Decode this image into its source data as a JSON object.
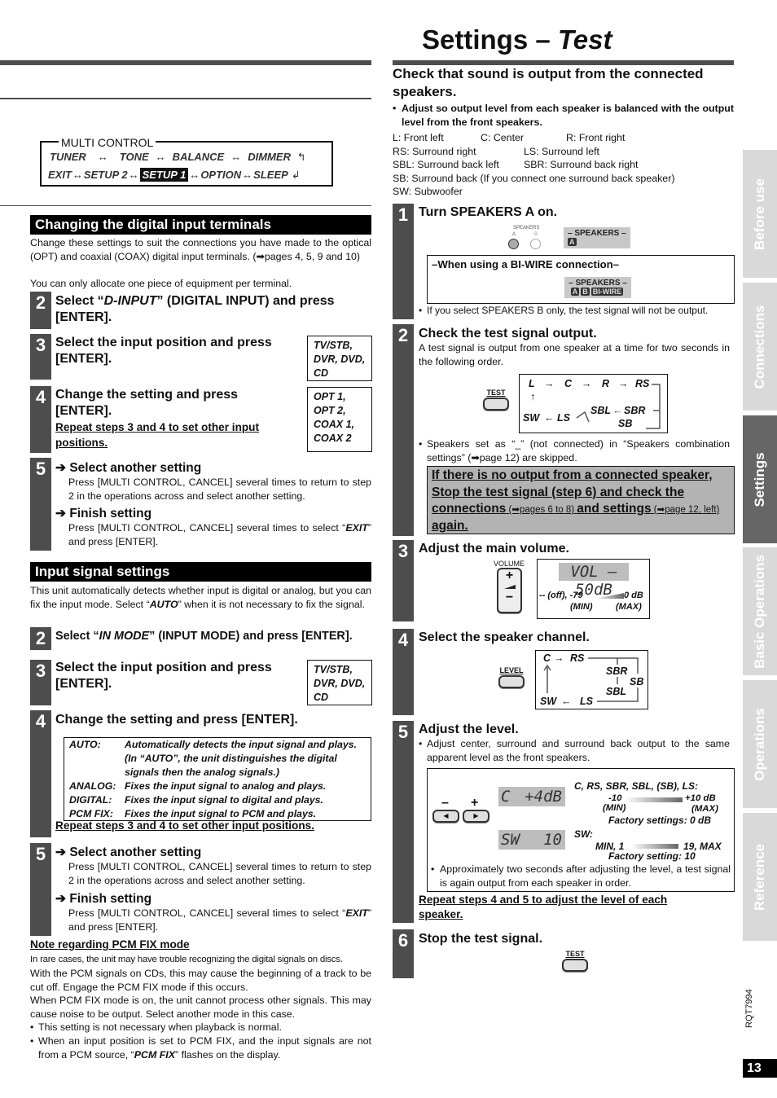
{
  "page": {
    "title_main": "Settings – ",
    "title_italic": "Test",
    "doc_code": "RQT7994",
    "page_number": "13"
  },
  "multi_control": {
    "legend": "MULTI CONTROL",
    "row1": [
      "TUNER",
      "TONE",
      "BALANCE",
      "DIMMER"
    ],
    "row2": [
      "EXIT",
      "SETUP 2",
      "SETUP 1",
      "OPTION",
      "SLEEP"
    ],
    "highlighted": "SETUP 1",
    "sep": "↔"
  },
  "digital_input": {
    "header": "Changing the digital input terminals",
    "intro1": "Change these settings to suit the connections you have made to the optical (OPT) and coaxial (COAX) digital input terminals. (➡pages 4, 5, 9 and 10)",
    "intro2": "You can only allocate one piece of equipment per terminal.",
    "step2": {
      "num": "2",
      "pre": "Select “",
      "ital": "D-INPUT",
      "post": "” (DIGITAL INPUT) and press [ENTER]."
    },
    "step3": {
      "num": "3",
      "title": "Select the input position and press [ENTER].",
      "options": [
        "TV/STB,",
        "DVR, DVD,",
        "CD"
      ]
    },
    "step4": {
      "num": "4",
      "title": "Change the setting and press [ENTER].",
      "repeat": "Repeat steps 3 and 4 to set other input positions.",
      "options": [
        "OPT 1,",
        "OPT 2,",
        "COAX 1,",
        "COAX 2"
      ]
    },
    "step5": {
      "num": "5",
      "another_head": "Select another setting",
      "another_text": "Press [MULTI CONTROL, CANCEL] several times to return to step 2 in the operations across and select another setting.",
      "finish_head": "Finish setting",
      "finish_text_pre": "Press [MULTI CONTROL, CANCEL] several times to select “",
      "finish_text_ital": "EXIT",
      "finish_text_post": "” and press [ENTER]."
    }
  },
  "input_signal": {
    "header": "Input signal settings",
    "intro_pre": "This unit automatically detects whether input is digital or analog, but you can fix the input mode. Select “",
    "intro_ital": "AUTO",
    "intro_post": "” when it is not necessary to fix the signal.",
    "step2": {
      "num": "2",
      "pre": "Select “",
      "ital": "IN MODE",
      "post": "” (INPUT MODE) and press  [ENTER]."
    },
    "step3": {
      "num": "3",
      "title": "Select the input position and press [ENTER].",
      "options": [
        "TV/STB,",
        "DVR, DVD,",
        "CD"
      ]
    },
    "step4": {
      "num": "4",
      "title": "Change the setting and press  [ENTER].",
      "modes": [
        {
          "key": "AUTO:",
          "desc": "Automatically detects the input signal and plays. (In “AUTO”, the unit distinguishes the digital signals then the analog signals.)"
        },
        {
          "key": "ANALOG:",
          "desc": "Fixes the input signal to analog and plays."
        },
        {
          "key": "DIGITAL:",
          "desc": "Fixes the input signal to digital and plays."
        },
        {
          "key": "PCM FIX:",
          "desc": "Fixes the input signal to PCM and plays."
        }
      ],
      "repeat": "Repeat steps 3 and 4 to set other input positions."
    },
    "step5": {
      "num": "5",
      "another_head": "Select another setting",
      "another_text": "Press [MULTI CONTROL, CANCEL] several times to return to step 2 in the operations across and select another setting.",
      "finish_head": "Finish setting",
      "finish_text_pre": "Press [MULTI CONTROL, CANCEL] several times to select “",
      "finish_text_ital": "EXIT",
      "finish_text_post": "” and press [ENTER]."
    },
    "note": {
      "head": "Note regarding PCM FIX mode",
      "p1": "In rare cases, the unit may have trouble recognizing the digital signals on discs.",
      "p2": "With the PCM signals on CDs, this may cause the beginning of a track to be cut off. Engage the PCM FIX mode if this occurs.",
      "p3": "When PCM FIX mode is on, the unit cannot process other signals. This may cause noise to be output. Select another mode in this case.",
      "b1": "This setting is not necessary when playback is normal.",
      "b2_pre": "When an input position is set to PCM FIX, and the input signals are not from a PCM source, “",
      "b2_ital": "PCM FIX",
      "b2_post": "” flashes on the display."
    }
  },
  "test": {
    "heading": "Check that sound is output from the connected speakers.",
    "bullet": "Adjust so output level from each speaker is balanced with the output level from the front speakers.",
    "legend": {
      "L": "L: Front left",
      "C": "C: Center",
      "R": "R: Front right",
      "RS": "RS: Surround right",
      "LS": "LS: Surround left",
      "SBL": "SBL: Surround back left",
      "SBR": "SBR: Surround back right",
      "SB": "SB: Surround back (If you connect one surround back speaker)",
      "SW": "SW: Subwoofer"
    },
    "step1": {
      "num": "1",
      "title": "Turn SPEAKERS A on.",
      "spk_label": "SPEAKERS",
      "spk_a": "A",
      "spk_b": "B",
      "panel_title": "– SPEAKERS –",
      "chip_a": "A",
      "chip_b": "B",
      "chip_biwire": "BI-WIRE",
      "biwire_title": "–When using a BI-WIRE connection–",
      "note": "If you select SPEAKERS B only, the test signal will not be output."
    },
    "step2": {
      "num": "2",
      "title": "Check the test signal output.",
      "text": "A test signal is output from one speaker at a time for two seconds in the following order.",
      "button": "TEST",
      "flow": {
        "L": "L",
        "C": "C",
        "R": "R",
        "RS": "RS",
        "SBL": "SBL",
        "SBR": "SBR",
        "SB": "SB",
        "SW": "SW",
        "LS": "LS"
      },
      "note": "Speakers set as “_” (not connected) in “Speakers combination settings” (➡page 12)  are skipped.",
      "warn1": "If there is no output from a connected speaker, Stop the test signal (step 6) and check the connections",
      "warn_ref1": " (➡pages 6 to 8) ",
      "warn2": "and settings",
      "warn_ref2": " (➡page 12, left) ",
      "warn3": "again."
    },
    "step3": {
      "num": "3",
      "title": "Adjust the main volume.",
      "vol_label": "VOLUME",
      "plus": "+",
      "minus": "−",
      "lcd": "VOL – 50dB",
      "range_min": "-- (off), -79",
      "range_max": "0 dB",
      "min_label": "(MIN)",
      "max_label": "(MAX)"
    },
    "step4": {
      "num": "4",
      "title": "Select the speaker channel.",
      "button": "LEVEL",
      "flow": {
        "C": "C",
        "RS": "RS",
        "SBR": "SBR",
        "SB": "SB",
        "SBL": "SBL",
        "SW": "SW",
        "LS": "LS"
      }
    },
    "step5": {
      "num": "5",
      "title": "Adjust the level.",
      "bullet": "Adjust center, surround and surround back output to the same apparent level as the front speakers.",
      "minus": "–",
      "plus": "+",
      "lcd1_ch": "C",
      "lcd1_val": "+4dB",
      "lcd2_ch": "SW",
      "lcd2_val": "10",
      "ch_label": "C, RS, SBR, SBL, (SB), LS:",
      "ch_min": "-10",
      "ch_max": "+10 dB",
      "ch_min_l": "(MIN)",
      "ch_max_l": "(MAX)",
      "ch_factory": "Factory settings: 0 dB",
      "sw_label": "SW:",
      "sw_min": "MIN, 1",
      "sw_max": "19, MAX",
      "sw_factory": "Factory setting: 10",
      "bullet2": "Approximately two seconds after adjusting the level, a test signal is again output from each speaker in order.",
      "repeat": "Repeat steps 4 and 5 to adjust the level of each speaker."
    },
    "step6": {
      "num": "6",
      "title": "Stop the test signal.",
      "button": "TEST"
    }
  },
  "tabs": [
    {
      "label": "Before use",
      "active": false
    },
    {
      "label": "Connections",
      "active": false
    },
    {
      "label": "Settings",
      "active": true
    },
    {
      "label": "Basic Operations",
      "active": false
    },
    {
      "label": "Operations",
      "active": false
    },
    {
      "label": "Reference",
      "active": false
    }
  ]
}
